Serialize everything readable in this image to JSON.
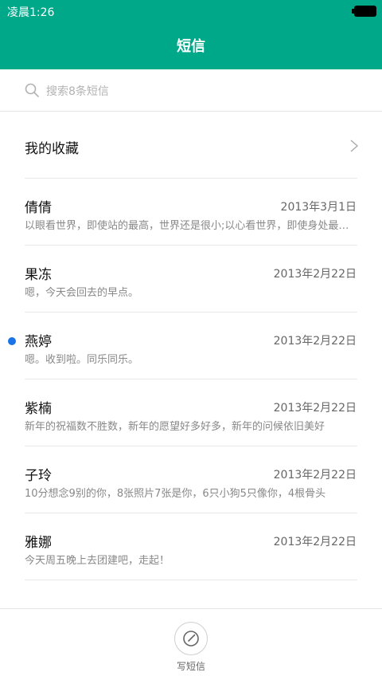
{
  "status_bar": {
    "time": "凌晨1:26"
  },
  "header": {
    "title": "短信"
  },
  "search": {
    "placeholder": "搜索8条短信"
  },
  "favorites": {
    "label": "我的收藏"
  },
  "messages": [
    {
      "name": "倩倩",
      "date": "2013年3月1日",
      "preview": "以眼看世界，即使站的最高，世界还是很小;以心看世界，即使身处最低，世界也是无穷大",
      "unread": false
    },
    {
      "name": "果冻",
      "date": "2013年2月22日",
      "preview": "嗯，今天会回去的早点。",
      "unread": false
    },
    {
      "name": "燕婷",
      "date": "2013年2月22日",
      "preview": "嗯。收到啦。同乐同乐。",
      "unread": true
    },
    {
      "name": "紫楠",
      "date": "2013年2月22日",
      "preview": "新年的祝福数不胜数，新年的愿望好多好多，新年的问候依旧美好",
      "unread": false
    },
    {
      "name": "子玲",
      "date": "2013年2月22日",
      "preview": "10分想念9别的你，8张照片7张是你，6只小狗5只像你，4根骨头",
      "unread": false
    },
    {
      "name": "雅娜",
      "date": "2013年2月22日",
      "preview": "今天周五晚上去团建吧，走起！",
      "unread": false
    }
  ],
  "bottom_bar": {
    "compose_label": "写短信"
  },
  "colors": {
    "header": "#00a88a",
    "unread_dot": "#1a73e8"
  }
}
